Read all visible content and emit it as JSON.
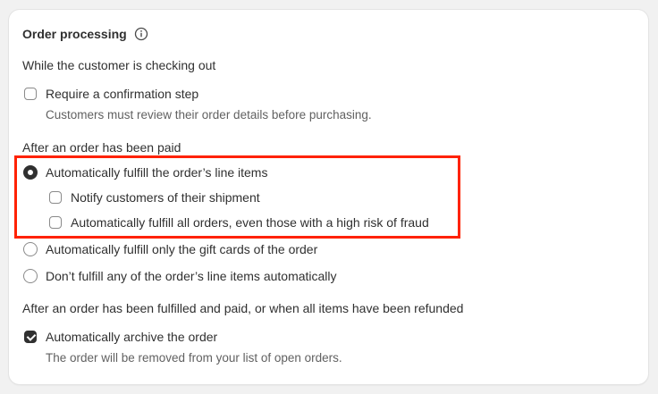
{
  "card": {
    "title": "Order processing"
  },
  "checkout": {
    "label": "While the customer is checking out",
    "confirmation": {
      "label": "Require a confirmation step",
      "help": "Customers must review their order details before purchasing.",
      "checked": false
    }
  },
  "paid": {
    "label": "After an order has been paid",
    "options": [
      {
        "label": "Automatically fulfill the order’s line items",
        "selected": true
      },
      {
        "label": "Automatically fulfill only the gift cards of the order",
        "selected": false
      },
      {
        "label": "Don’t fulfill any of the order’s line items automatically",
        "selected": false
      }
    ],
    "sub_options": [
      {
        "label": "Notify customers of their shipment",
        "checked": false
      },
      {
        "label": "Automatically fulfill all orders, even those with a high risk of fraud",
        "checked": false
      }
    ]
  },
  "fulfilled": {
    "label": "After an order has been fulfilled and paid, or when all items have been refunded",
    "archive": {
      "label": "Automatically archive the order",
      "help": "The order will be removed from your list of open orders.",
      "checked": true
    }
  },
  "colors": {
    "highlight": "#ff2200",
    "text": "#303030",
    "subdued": "#616161"
  }
}
